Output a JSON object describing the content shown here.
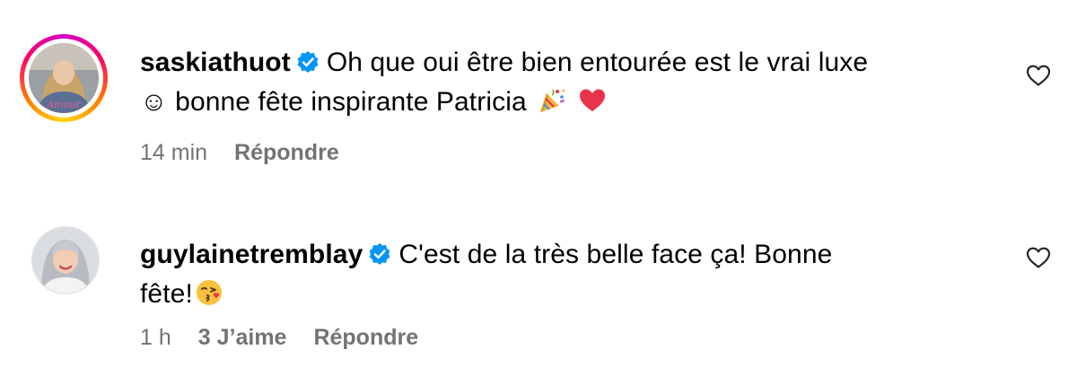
{
  "comments": [
    {
      "username": "saskiathuot",
      "text_line1": "Oh que oui être bien entourée est le vrai luxe",
      "smiley": "☺",
      "text_line2": "bonne fête inspirante Patricia",
      "emojis": [
        "party-popper-icon",
        "red-heart-icon"
      ],
      "avatar_caption": "Amour",
      "time": "14 min",
      "reply_label": "Répondre",
      "has_story_ring": true
    },
    {
      "username": "guylainetremblay",
      "text_line1": "C'est de la très belle face ça! Bonne",
      "text_line2": "fête!",
      "emojis": [
        "kissing-face-icon"
      ],
      "time": "1 h",
      "likes": "3 J’aime",
      "reply_label": "Répondre",
      "has_story_ring": false
    }
  ],
  "colors": {
    "text": "#000000",
    "meta": "#737373",
    "verified": "#0095f6",
    "heart_emoji": "#e8334a"
  }
}
